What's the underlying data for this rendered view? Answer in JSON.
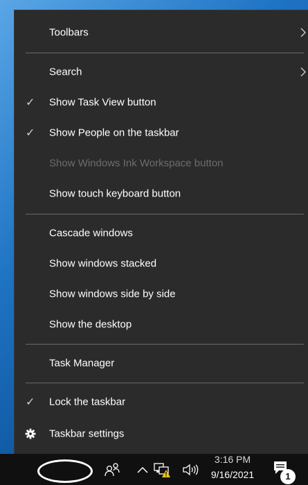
{
  "menu": {
    "items": [
      {
        "label": "Toolbars",
        "submenu": true,
        "checked": false,
        "disabled": false
      },
      {
        "label": "Search",
        "submenu": true,
        "checked": false,
        "disabled": false
      },
      {
        "label": "Show Task View button",
        "submenu": false,
        "checked": true,
        "disabled": false
      },
      {
        "label": "Show People on the taskbar",
        "submenu": false,
        "checked": true,
        "disabled": false
      },
      {
        "label": "Show Windows Ink Workspace button",
        "submenu": false,
        "checked": false,
        "disabled": true
      },
      {
        "label": "Show touch keyboard button",
        "submenu": false,
        "checked": false,
        "disabled": false
      },
      {
        "label": "Cascade windows",
        "submenu": false,
        "checked": false,
        "disabled": false
      },
      {
        "label": "Show windows stacked",
        "submenu": false,
        "checked": false,
        "disabled": false
      },
      {
        "label": "Show windows side by side",
        "submenu": false,
        "checked": false,
        "disabled": false
      },
      {
        "label": "Show the desktop",
        "submenu": false,
        "checked": false,
        "disabled": false
      },
      {
        "label": "Task Manager",
        "submenu": false,
        "checked": false,
        "disabled": false
      },
      {
        "label": "Lock the taskbar",
        "submenu": false,
        "checked": true,
        "disabled": false
      },
      {
        "label": "Taskbar settings",
        "submenu": false,
        "checked": false,
        "disabled": false,
        "icon": "gear-icon"
      }
    ],
    "check_glyph": "✓"
  },
  "taskbar": {
    "clock": {
      "time": "3:16 PM",
      "date": "9/16/2021"
    },
    "notification_count": "1",
    "tray_icons": [
      "people-icon",
      "chevron-up-icon",
      "network-warning-icon",
      "speaker-icon",
      "action-center-icon"
    ]
  },
  "colors": {
    "menu_bg": "#2b2b2b",
    "menu_text": "#ffffff",
    "disabled_text": "#6d6d6d",
    "separator": "#6a6a6a",
    "taskbar_bg": "#101010"
  }
}
